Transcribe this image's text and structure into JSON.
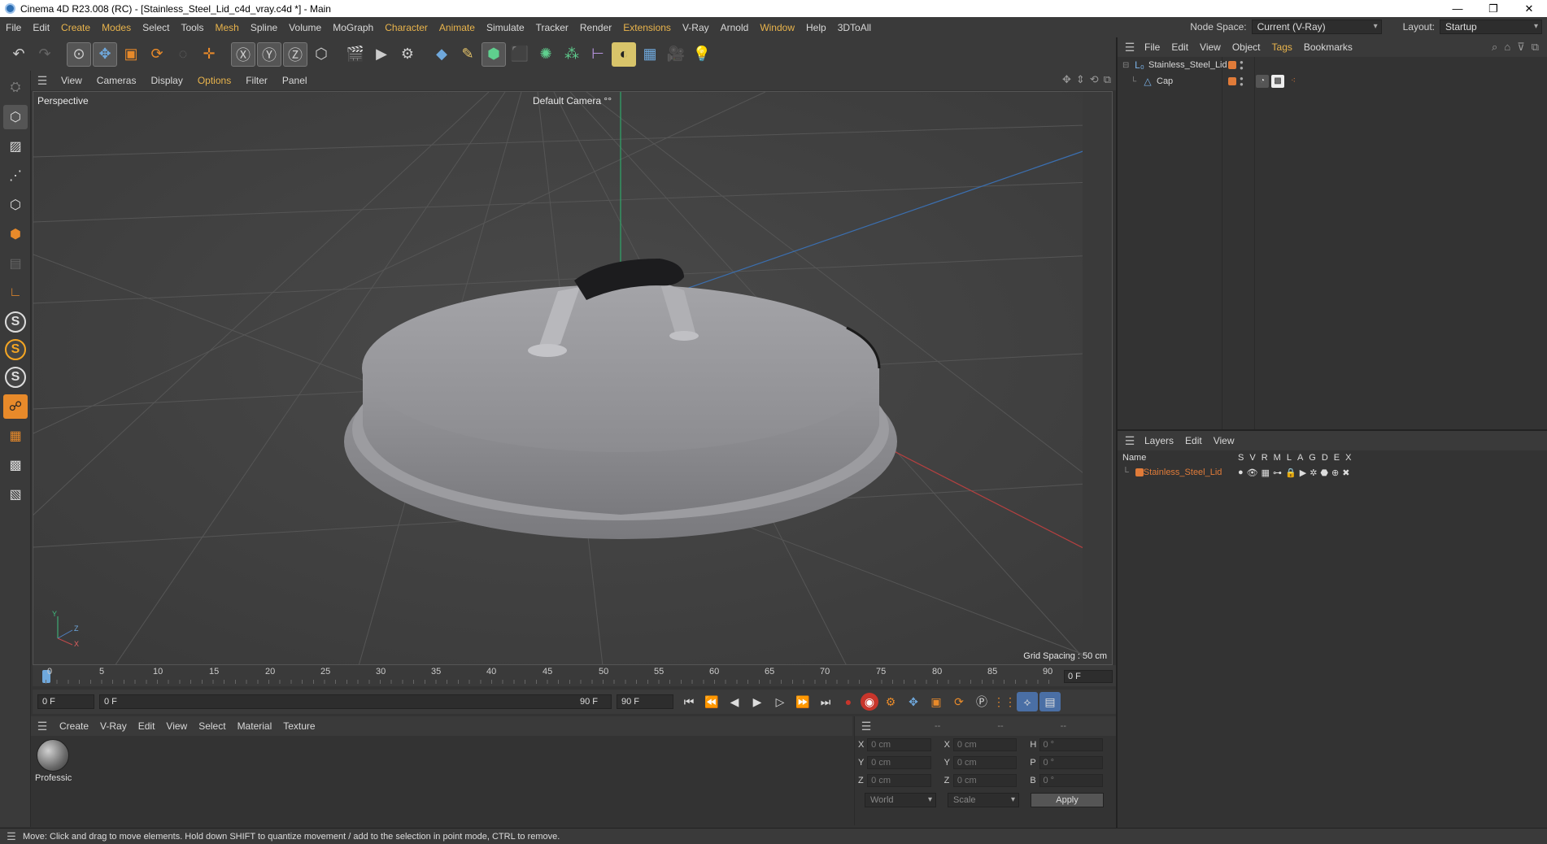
{
  "window": {
    "title": "Cinema 4D R23.008 (RC) - [Stainless_Steel_Lid_c4d_vray.c4d *] - Main",
    "controls": [
      "—",
      "❐",
      "✕"
    ]
  },
  "menubar": {
    "items": [
      "File",
      "Edit",
      "Create",
      "Modes",
      "Select",
      "Tools",
      "Mesh",
      "Spline",
      "Volume",
      "MoGraph",
      "Character",
      "Animate",
      "Simulate",
      "Tracker",
      "Render",
      "Extensions",
      "V-Ray",
      "Arnold",
      "Window",
      "Help",
      "3DToAll"
    ],
    "highlighted": [
      "Create",
      "Modes",
      "Mesh",
      "Character",
      "Animate",
      "Extensions",
      "Window"
    ],
    "node_space_label": "Node Space:",
    "node_space_value": "Current (V-Ray)",
    "layout_label": "Layout:",
    "layout_value": "Startup"
  },
  "viewport_menu": {
    "items": [
      "View",
      "Cameras",
      "Display",
      "Options",
      "Filter",
      "Panel"
    ],
    "highlighted": [
      "Options"
    ]
  },
  "viewport": {
    "label": "Perspective",
    "camera": "Default Camera",
    "camera_icon": "°°",
    "grid_spacing": "Grid Spacing : 50 cm",
    "axis_y": "Y",
    "axis_z": "Z",
    "axis_x": "X"
  },
  "timeline": {
    "ticks": [
      "0",
      "5",
      "10",
      "15",
      "20",
      "25",
      "30",
      "35",
      "40",
      "45",
      "50",
      "55",
      "60",
      "65",
      "70",
      "75",
      "80",
      "85",
      "90"
    ],
    "current_frame": "0 F"
  },
  "controls": {
    "start_frame": "0 F",
    "range_start": "0 F",
    "range_end": "90 F",
    "end_frame": "90 F"
  },
  "material_menu": {
    "items": [
      "Create",
      "V-Ray",
      "Edit",
      "View",
      "Select",
      "Material",
      "Texture"
    ],
    "material_name": "Professic"
  },
  "coordinates": {
    "headers": [
      "--",
      "--",
      "--"
    ],
    "rows": [
      {
        "a": "X",
        "av": "0 cm",
        "b": "X",
        "bv": "0 cm",
        "c": "H",
        "cv": "0 °"
      },
      {
        "a": "Y",
        "av": "0 cm",
        "b": "Y",
        "bv": "0 cm",
        "c": "P",
        "cv": "0 °"
      },
      {
        "a": "Z",
        "av": "0 cm",
        "b": "Z",
        "bv": "0 cm",
        "c": "B",
        "cv": "0 °"
      }
    ],
    "world": "World",
    "scale": "Scale",
    "apply": "Apply"
  },
  "object_manager": {
    "menu": [
      "File",
      "Edit",
      "View",
      "Object",
      "Tags",
      "Bookmarks"
    ],
    "highlighted": [
      "Tags"
    ],
    "objects": [
      {
        "name": "Stainless_Steel_Lid"
      },
      {
        "name": "Cap"
      }
    ]
  },
  "layer_manager": {
    "menu": [
      "Layers",
      "Edit",
      "View"
    ],
    "name_header": "Name",
    "columns": [
      "S",
      "V",
      "R",
      "M",
      "L",
      "A",
      "G",
      "D",
      "E",
      "X"
    ],
    "layer_name": "Stainless_Steel_Lid"
  },
  "status": {
    "text": "Move: Click and drag to move elements. Hold down SHIFT to quantize movement / add to the selection in point mode, CTRL to remove."
  },
  "colors": {
    "accent_orange": "#e07b39",
    "menu_highlight": "#e9b44c",
    "viewport_bg": "#414141"
  }
}
